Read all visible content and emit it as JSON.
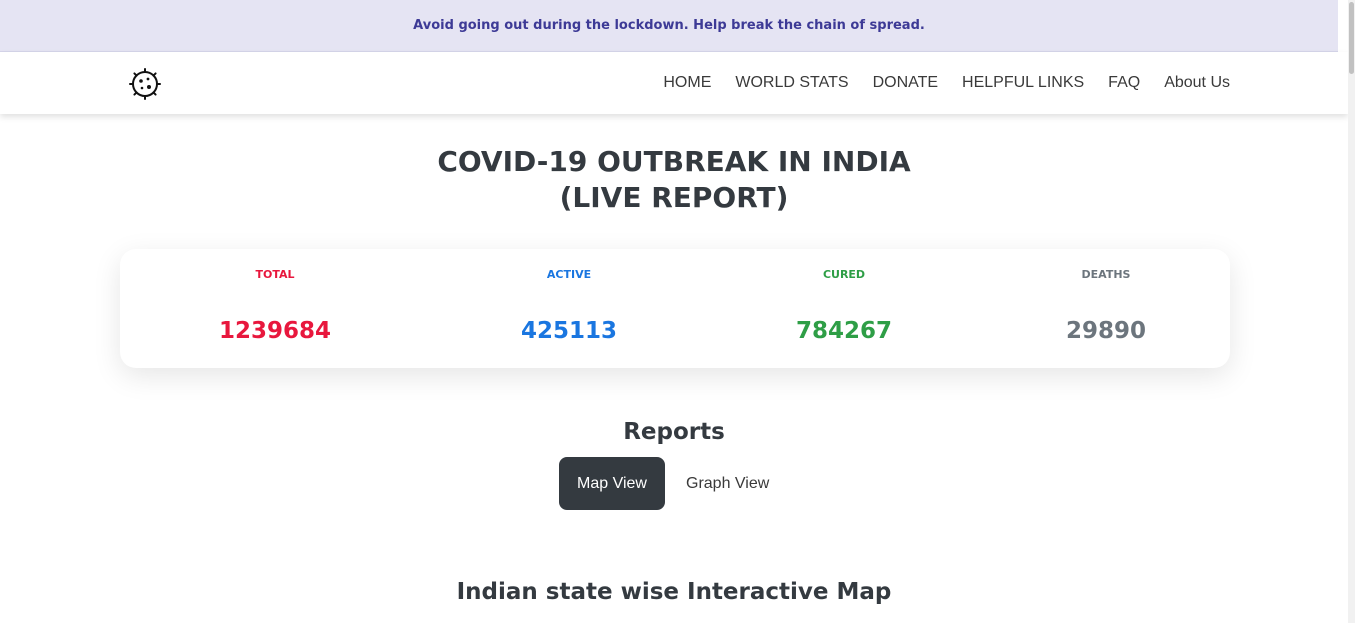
{
  "banner": {
    "text": "Avoid going out during the lockdown. Help break the chain of spread."
  },
  "nav": {
    "logo_icon": "virus-icon",
    "links": [
      "HOME",
      "WORLD STATS",
      "DONATE",
      "HELPFUL LINKS",
      "FAQ",
      "About Us"
    ]
  },
  "header": {
    "line1": "COVID-19 OUTBREAK IN INDIA",
    "line2": "(LIVE REPORT)"
  },
  "stats": {
    "total": {
      "label": "TOTAL",
      "value": "1239684",
      "color": "#e8173d"
    },
    "active": {
      "label": "ACTIVE",
      "value": "425113",
      "color": "#1a76e0"
    },
    "cured": {
      "label": "CURED",
      "value": "784267",
      "color": "#2e9e46"
    },
    "deaths": {
      "label": "DEATHS",
      "value": "29890",
      "color": "#6c757d"
    }
  },
  "reports": {
    "title": "Reports",
    "tabs": [
      "Map View",
      "Graph View"
    ],
    "active_tab": "Map View"
  },
  "map": {
    "title": "Indian state wise Interactive Map"
  }
}
